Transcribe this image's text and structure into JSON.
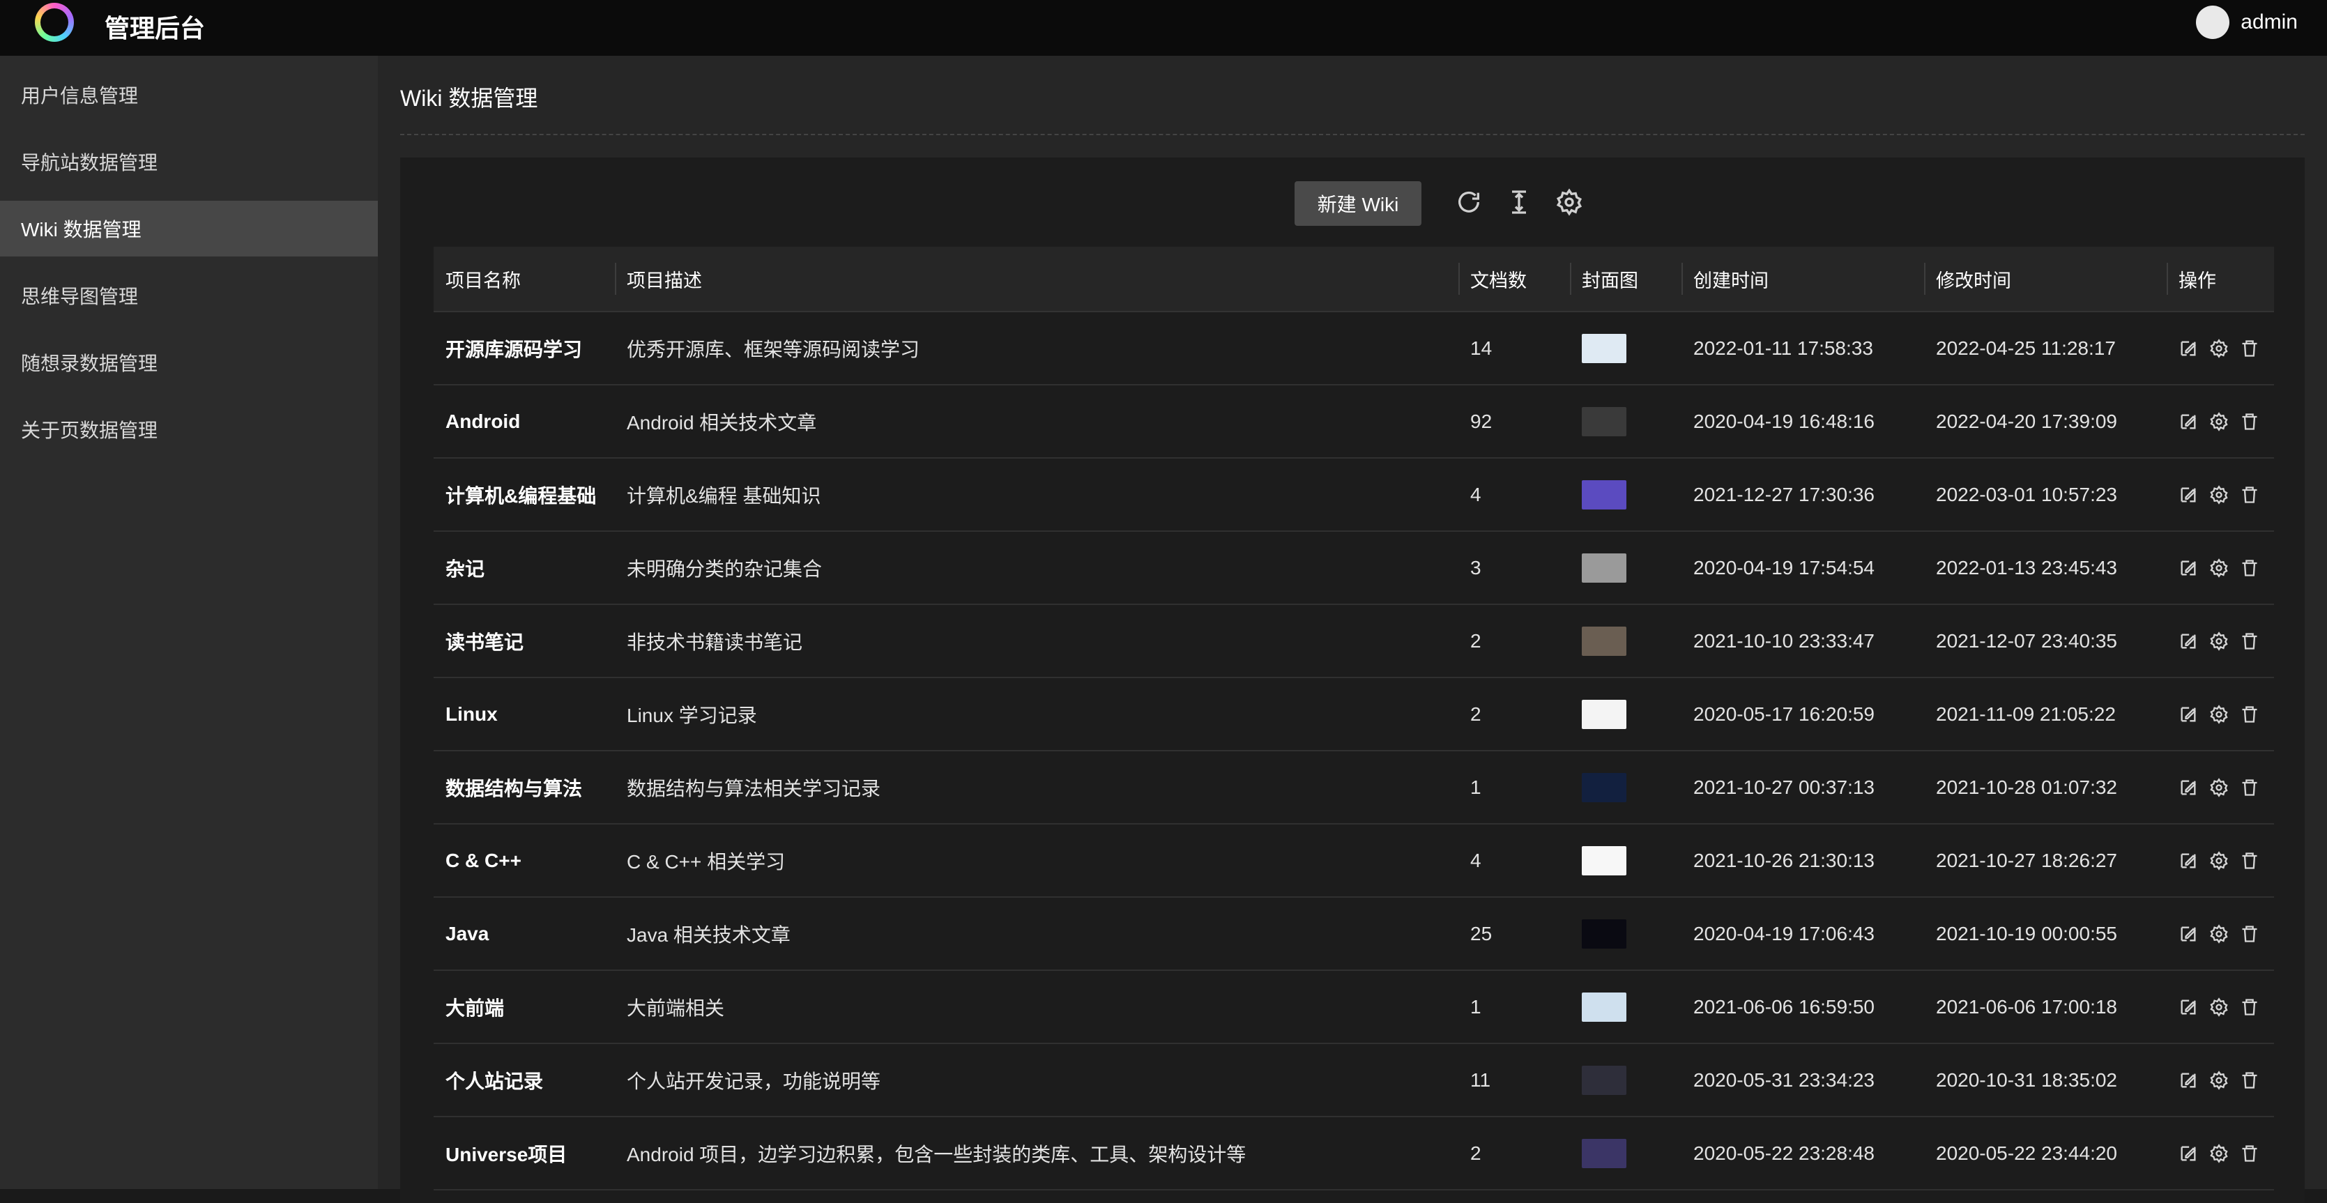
{
  "app": {
    "title": "管理后台",
    "user": "admin"
  },
  "sidebar": {
    "items": [
      {
        "label": "用户信息管理"
      },
      {
        "label": "导航站数据管理"
      },
      {
        "label": "Wiki 数据管理",
        "active": true
      },
      {
        "label": "思维导图管理"
      },
      {
        "label": "随想录数据管理"
      },
      {
        "label": "关于页数据管理"
      }
    ]
  },
  "page": {
    "title": "Wiki 数据管理"
  },
  "toolbar": {
    "new_label": "新建 Wiki",
    "icons": [
      "refresh-icon",
      "column-height-icon",
      "settings-icon"
    ]
  },
  "table": {
    "headers": [
      "项目名称",
      "项目描述",
      "文档数",
      "封面图",
      "创建时间",
      "修改时间",
      "操作"
    ],
    "rows": [
      {
        "name": "开源库源码学习",
        "desc": "优秀开源库、框架等源码阅读学习",
        "count": "14",
        "created": "2022-01-11 17:58:33",
        "modified": "2022-04-25 11:28:17",
        "cover": "#dfeaf3"
      },
      {
        "name": "Android",
        "desc": "Android 相关技术文章",
        "count": "92",
        "created": "2020-04-19 16:48:16",
        "modified": "2022-04-20 17:39:09",
        "cover": "#3a3a3a"
      },
      {
        "name": "计算机&编程基础",
        "desc": "计算机&编程 基础知识",
        "count": "4",
        "created": "2021-12-27 17:30:36",
        "modified": "2022-03-01 10:57:23",
        "cover": "#5b4bc0"
      },
      {
        "name": "杂记",
        "desc": "未明确分类的杂记集合",
        "count": "3",
        "created": "2020-04-19 17:54:54",
        "modified": "2022-01-13 23:45:43",
        "cover": "#9a9a9a"
      },
      {
        "name": "读书笔记",
        "desc": "非技术书籍读书笔记",
        "count": "2",
        "created": "2021-10-10 23:33:47",
        "modified": "2021-12-07 23:40:35",
        "cover": "#6a5e52"
      },
      {
        "name": "Linux",
        "desc": "Linux 学习记录",
        "count": "2",
        "created": "2020-05-17 16:20:59",
        "modified": "2021-11-09 21:05:22",
        "cover": "#f4f4f4"
      },
      {
        "name": "数据结构与算法",
        "desc": "数据结构与算法相关学习记录",
        "count": "1",
        "created": "2021-10-27 00:37:13",
        "modified": "2021-10-28 01:07:32",
        "cover": "#12203f"
      },
      {
        "name": "C & C++",
        "desc": "C & C++ 相关学习",
        "count": "4",
        "created": "2021-10-26 21:30:13",
        "modified": "2021-10-27 18:26:27",
        "cover": "#f7f7f7"
      },
      {
        "name": "Java",
        "desc": "Java 相关技术文章",
        "count": "25",
        "created": "2020-04-19 17:06:43",
        "modified": "2021-10-19 00:00:55",
        "cover": "#0a0a12"
      },
      {
        "name": "大前端",
        "desc": "大前端相关",
        "count": "1",
        "created": "2021-06-06 16:59:50",
        "modified": "2021-06-06 17:00:18",
        "cover": "#cfe0ee"
      },
      {
        "name": "个人站记录",
        "desc": "个人站开发记录，功能说明等",
        "count": "11",
        "created": "2020-05-31 23:34:23",
        "modified": "2020-10-31 18:35:02",
        "cover": "#2e2e3a"
      },
      {
        "name": "Universe项目",
        "desc": "Android 项目，边学习边积累，包含一些封装的类库、工具、架构设计等",
        "count": "2",
        "created": "2020-05-22 23:28:48",
        "modified": "2020-05-22 23:44:20",
        "cover": "#3b3566"
      }
    ]
  }
}
